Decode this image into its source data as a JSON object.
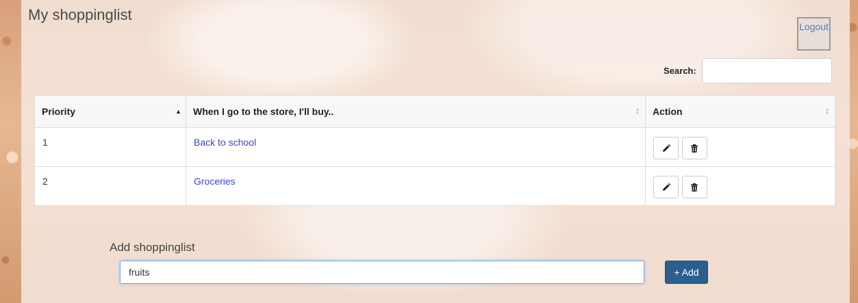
{
  "page": {
    "title": "My shoppinglist"
  },
  "header": {
    "logout_label": "Logout"
  },
  "search": {
    "label": "Search:",
    "value": ""
  },
  "table": {
    "columns": [
      {
        "label": "Priority",
        "sort": "ascending"
      },
      {
        "label": "When I go to the store, I'll buy..",
        "sort": "none"
      },
      {
        "label": "Action",
        "sort": "none"
      }
    ],
    "rows": [
      {
        "priority": "1",
        "name": "Back to school",
        "actions": [
          "edit-pencil-icon",
          "delete-trash-icon"
        ]
      },
      {
        "priority": "2",
        "name": "Groceries",
        "actions": [
          "edit-pencil-icon",
          "delete-trash-icon"
        ]
      }
    ]
  },
  "add_form": {
    "label": "Add shoppinglist",
    "input_value": "fruits",
    "button_label": "+ Add"
  },
  "colors": {
    "link": "#3a44c7",
    "primary_button": "#2b5f90",
    "logout_text": "#4a7fc0",
    "focus_border": "#66afe9"
  }
}
